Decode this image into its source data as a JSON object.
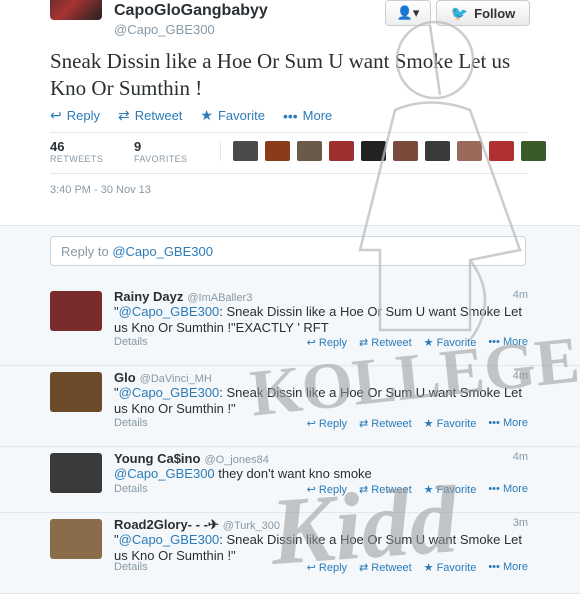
{
  "header": {
    "name": "CapoGloGangbabyy",
    "handle": "@Capo_GBE300",
    "user_menu_icon": "👤▾",
    "follow_label": "Follow"
  },
  "tweet": {
    "text": "Sneak Dissin like a Hoe Or Sum U want Smoke Let us Kno Or Sumthin !",
    "actions": {
      "reply": "Reply",
      "retweet": "Retweet",
      "favorite": "Favorite",
      "more": "More"
    },
    "stats": {
      "retweets": "46",
      "retweets_label": "RETWEETS",
      "favorites": "9",
      "favorites_label": "FAVORITES"
    },
    "timestamp": "3:40 PM - 30 Nov 13"
  },
  "reply_box": {
    "prefix": "Reply to ",
    "mention": "@Capo_GBE300"
  },
  "replies": [
    {
      "name": "Rainy Dayz",
      "handle": "@ImABaller3",
      "time": "4m",
      "mention": "@Capo_GBE300",
      "text": ": Sneak Dissin like a Hoe Or Sum U want Smoke Let us Kno Or Sumthin !\"EXACTLY ' RFT",
      "details": "Details",
      "reply": "Reply",
      "retweet": "Retweet",
      "favorite": "Favorite",
      "more": "More",
      "avatar_color": "#7a2b2b"
    },
    {
      "name": "Glo",
      "handle": "@DaVinci_MH",
      "time": "4m",
      "mention": "@Capo_GBE300",
      "text": ": Sneak Dissin like a Hoe Or Sum U want Smoke Let us Kno Or Sumthin !\"",
      "details": "Details",
      "reply": "Reply",
      "retweet": "Retweet",
      "favorite": "Favorite",
      "more": "More",
      "avatar_color": "#6b4a2a"
    },
    {
      "name": "Young Ca$ino",
      "handle": "@O_jones84",
      "time": "4m",
      "mention": "@Capo_GBE300",
      "text": " they don't want kno smoke",
      "details": "Details",
      "reply": "Reply",
      "retweet": "Retweet",
      "favorite": "Favorite",
      "more": "More",
      "avatar_color": "#3a3a3a"
    },
    {
      "name": "Road2Glory- - -✈",
      "handle": "@Turk_300",
      "time": "3m",
      "mention": "@Capo_GBE300",
      "text": ": Sneak Dissin like a Hoe Or Sum U want Smoke Let us Kno Or Sumthin !\"",
      "details": "Details",
      "reply": "Reply",
      "retweet": "Retweet",
      "favorite": "Favorite",
      "more": "More",
      "avatar_color": "#8a6b4a"
    }
  ],
  "watermark": "KOLLEGE Kidd",
  "colors": {
    "link": "#2b7bb9",
    "muted": "#8899a6",
    "text": "#292f33"
  }
}
